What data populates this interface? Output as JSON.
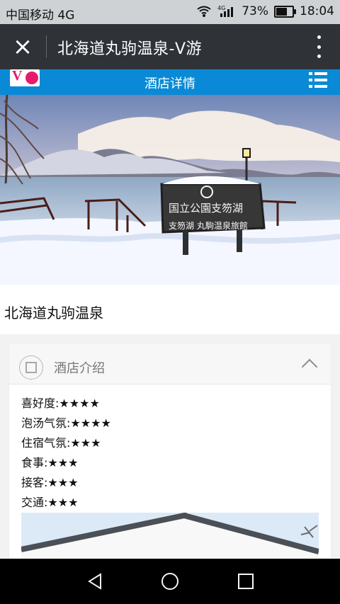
{
  "status_bar": {
    "carrier": "中国移动 4G",
    "network_label": "4G",
    "battery_percent": "73%",
    "time": "18:04",
    "battery_level": 0.73
  },
  "wechat_header": {
    "title": "北海道丸驹温泉-V游"
  },
  "app_bar": {
    "title": "酒店详情"
  },
  "hero": {
    "sign_line1": "国立公園支笏湖",
    "sign_line2": "支笏湖 丸駒温泉旅館"
  },
  "hotel": {
    "name": "北海道丸驹温泉"
  },
  "intro": {
    "title": "酒店介绍"
  },
  "ratings": [
    {
      "label": "喜好度:",
      "stars": "★★★★"
    },
    {
      "label": "泡汤气氛:",
      "stars": "★★★★"
    },
    {
      "label": "住宿气氛:",
      "stars": "★★★"
    },
    {
      "label": "食事:",
      "stars": "★★★"
    },
    {
      "label": "接客:",
      "stars": "★★★"
    },
    {
      "label": "交通:",
      "stars": "★★★"
    }
  ],
  "colors": {
    "app_bar": "#0a8ad6",
    "wechat_header": "#2f3338"
  }
}
